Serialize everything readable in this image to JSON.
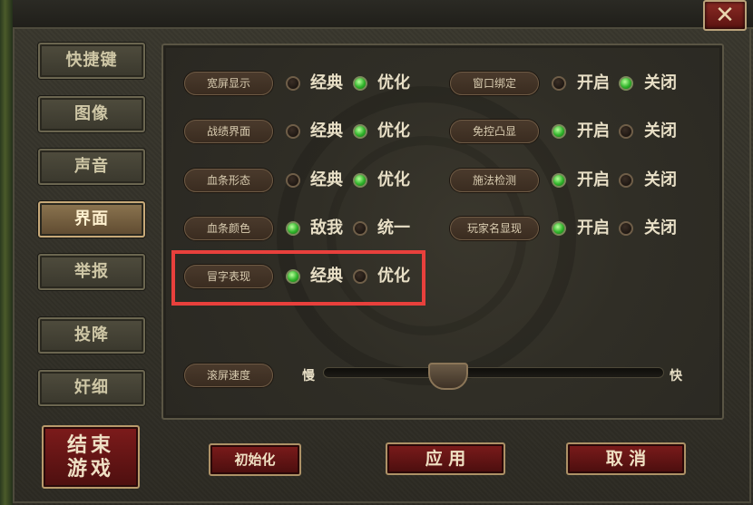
{
  "window": {
    "close_glyph": "✕"
  },
  "sidebar": {
    "items": [
      {
        "label": "快捷键",
        "active": false
      },
      {
        "label": "图像",
        "active": false
      },
      {
        "label": "声音",
        "active": false
      },
      {
        "label": "界面",
        "active": true
      },
      {
        "label": "举报",
        "active": false
      },
      {
        "label": "投降",
        "active": false
      },
      {
        "label": "奸细",
        "active": false
      }
    ],
    "end_game": {
      "line1": "结束",
      "line2": "游戏"
    }
  },
  "settings": {
    "left": [
      {
        "label": "宽屏显示",
        "opt1": "经典",
        "opt2": "优化",
        "selected": 2
      },
      {
        "label": "战绩界面",
        "opt1": "经典",
        "opt2": "优化",
        "selected": 2
      },
      {
        "label": "血条形态",
        "opt1": "经典",
        "opt2": "优化",
        "selected": 2
      },
      {
        "label": "血条颜色",
        "opt1": "敌我",
        "opt2": "统一",
        "selected": 1
      },
      {
        "label": "冒字表现",
        "opt1": "经典",
        "opt2": "优化",
        "selected": 1
      }
    ],
    "right": [
      {
        "label": "窗口绑定",
        "opt1": "开启",
        "opt2": "关闭",
        "selected": 2
      },
      {
        "label": "免控凸显",
        "opt1": "开启",
        "opt2": "关闭",
        "selected": 1
      },
      {
        "label": "施法检测",
        "opt1": "开启",
        "opt2": "关闭",
        "selected": 1
      },
      {
        "label": "玩家名显现",
        "opt1": "开启",
        "opt2": "关闭",
        "selected": 1
      }
    ]
  },
  "scroll_speed": {
    "label": "滚屏速度",
    "min_label": "慢",
    "max_label": "快",
    "value": 0.35
  },
  "buttons": {
    "reset": "初始化",
    "apply": "应 用",
    "cancel": "取 消"
  },
  "colors": {
    "highlight": "#e8403c",
    "radio_on": "#2fb32a"
  }
}
